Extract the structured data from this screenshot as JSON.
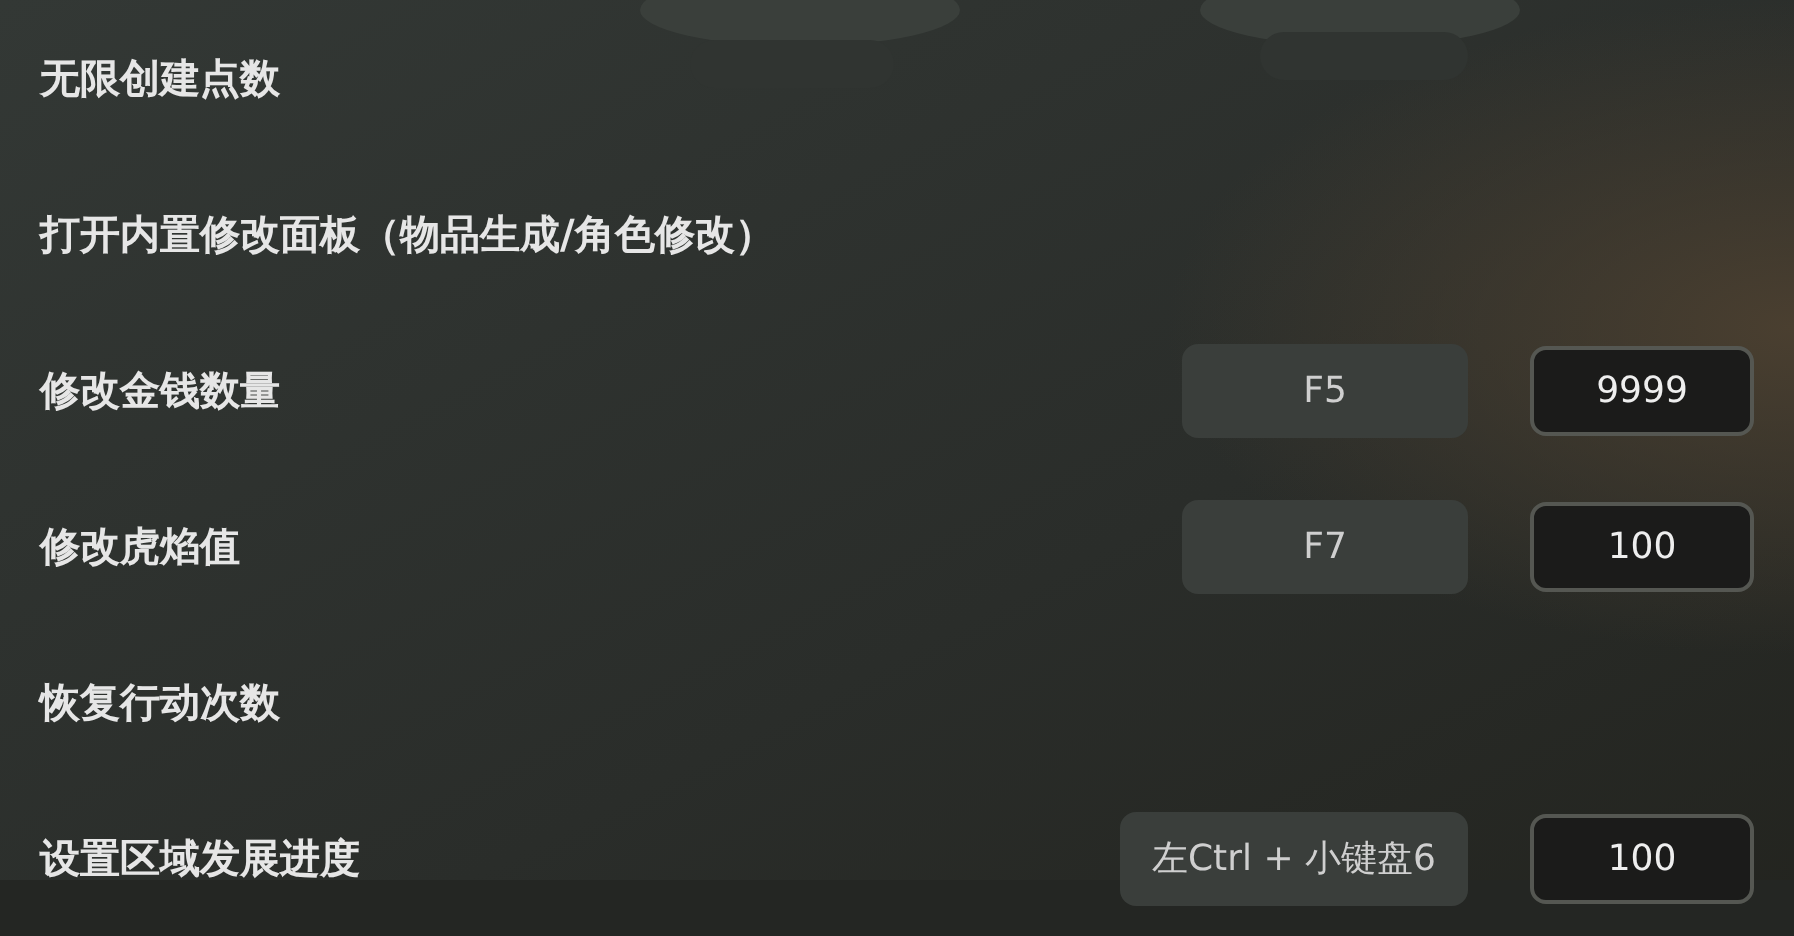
{
  "options": [
    {
      "label": "无限创建点数"
    },
    {
      "label": "打开内置修改面板（物品生成/角色修改）"
    },
    {
      "label": "修改金钱数量",
      "hotkey": "F5",
      "value": "9999"
    },
    {
      "label": "修改虎焰值",
      "hotkey": "F7",
      "value": "100"
    },
    {
      "label": "恢复行动次数"
    },
    {
      "label": "设置区域发展进度",
      "hotkey": "左Ctrl + 小键盘6",
      "value": "100"
    }
  ]
}
